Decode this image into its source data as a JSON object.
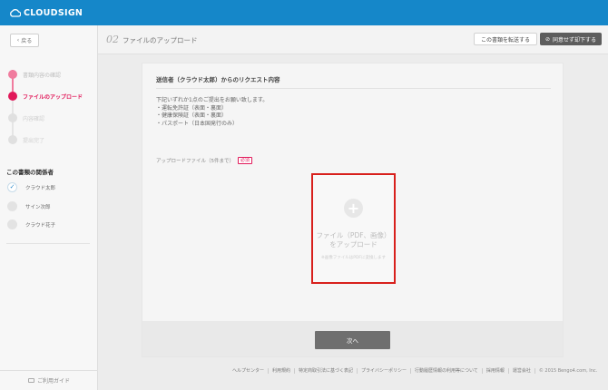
{
  "app": {
    "brand": "CLOUDSIGN"
  },
  "sidebar": {
    "back_label": "戻る",
    "steps": [
      {
        "label": "書類内容の確認",
        "state": "done"
      },
      {
        "label": "ファイルのアップロード",
        "state": "active"
      },
      {
        "label": "内容確認",
        "state": "pending"
      },
      {
        "label": "提出完了",
        "state": "pending"
      }
    ],
    "parties_title": "この書類の関係者",
    "parties": [
      {
        "name": "クラウド太郎",
        "checked": true
      },
      {
        "name": "サイン次郎",
        "checked": false
      },
      {
        "name": "クラウド花子",
        "checked": false
      }
    ],
    "guide_label": "ご利用ガイド"
  },
  "header": {
    "step_number": "02",
    "title": "ファイルのアップロード",
    "forward_label": "この書類を転送する",
    "decline_label": "同意せず却下する"
  },
  "request": {
    "title": "送信者（クラウド太郎）からのリクエスト内容",
    "body": "下記いずれか1点のご提出をお願い致します。\n・運転免許証（表面・裏面）\n・健康保険証（表面・裏面）\n・パスポート（日本国発行のみ）"
  },
  "upload": {
    "label": "アップロードファイル（5件まで）",
    "required_badge": "必須",
    "drop_main": "ファイル（PDF、画像）\nをアップロード",
    "drop_sub": "※画像ファイルはPDFに変換します"
  },
  "next_label": "次へ",
  "footer": {
    "links": [
      "ヘルプセンター",
      "利用規約",
      "特定商取引法に基づく表記",
      "プライバシーポリシー",
      "行動履歴情報の利用等について",
      "採用情報",
      "運営会社"
    ],
    "copyright": "© 2015 Bengo4.com, Inc."
  },
  "colors": {
    "brand_blue": "#1587c9",
    "active_pink": "#e1195a",
    "highlight_red": "#d8201c"
  }
}
